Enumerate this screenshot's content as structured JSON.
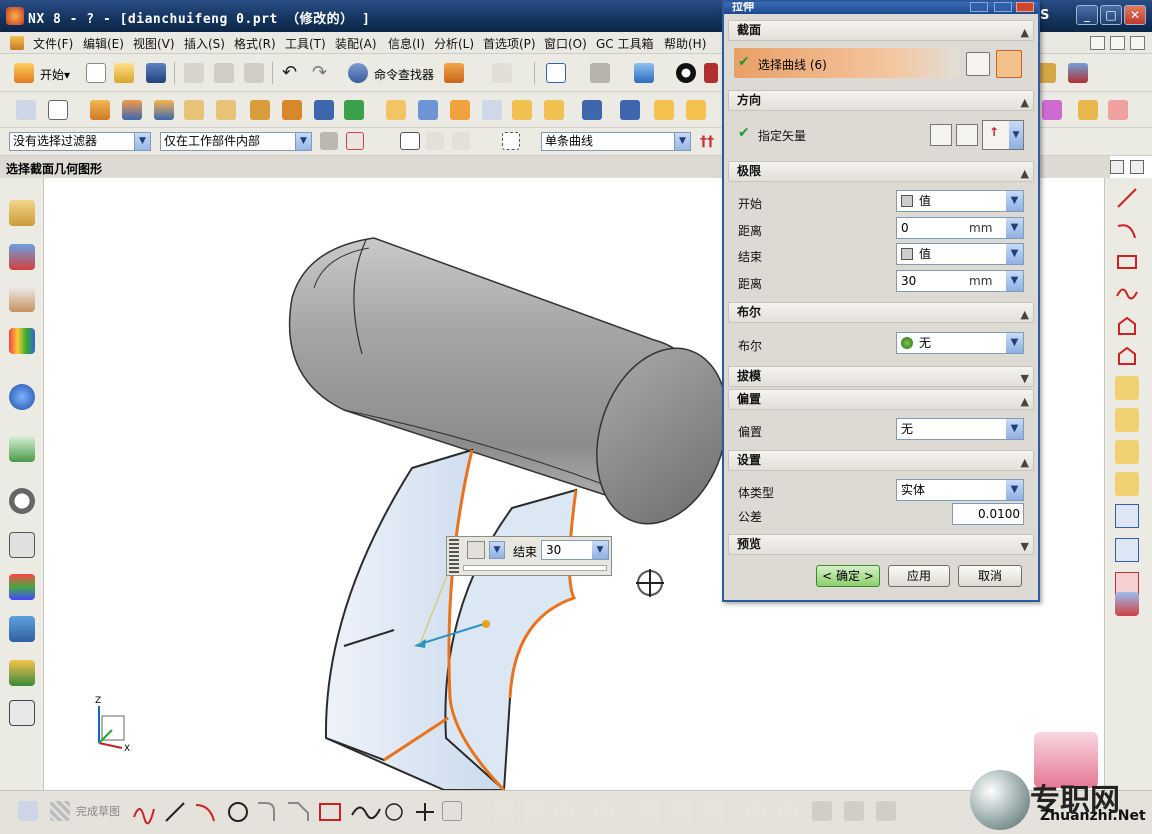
{
  "window": {
    "title": "NX 8 - ? - [dianchuifeng 0.prt （修改的） ]",
    "min": "_",
    "max": "□",
    "close": "✕",
    "brand": "S"
  },
  "menu": [
    "文件(F)",
    "编辑(E)",
    "视图(V)",
    "插入(S)",
    "格式(R)",
    "工具(T)",
    "装配(A)",
    "信息(I)",
    "分析(L)",
    "首选项(P)",
    "窗口(O)",
    "GC 工具箱",
    "帮助(H)"
  ],
  "toolbar1": {
    "start_label": "开始▾",
    "command_finder": "命令查找器"
  },
  "filters": {
    "selection_filter": "没有选择过滤器",
    "scope": "仅在工作部件内部",
    "curve_rule": "单条曲线"
  },
  "status": "选择截面几何图形",
  "dialog": {
    "title": "拉伸",
    "section": {
      "header": "截面",
      "select_curve": "选择曲线 (6)"
    },
    "direction": {
      "header": "方向",
      "specify_vector": "指定矢量"
    },
    "limits": {
      "header": "极限",
      "start_label": "开始",
      "start_value": "值",
      "start_distance_label": "距离",
      "start_distance": "0",
      "start_unit": "mm",
      "end_label": "结束",
      "end_value": "值",
      "end_distance_label": "距离",
      "end_distance": "30",
      "end_unit": "mm"
    },
    "boolean": {
      "header": "布尔",
      "label": "布尔",
      "value": "无"
    },
    "draft": {
      "header": "拔模"
    },
    "offset": {
      "header": "偏置",
      "label": "偏置",
      "value": "无"
    },
    "settings": {
      "header": "设置",
      "body_type_label": "体类型",
      "body_type": "实体",
      "tolerance_label": "公差",
      "tolerance": "0.0100"
    },
    "preview": {
      "header": "预览"
    },
    "ok": "< 确定 >",
    "apply": "应用",
    "cancel": "取消"
  },
  "floating": {
    "label": "结束",
    "value": "30"
  },
  "bottom": {
    "finish_sketch": "完成草图"
  },
  "triad": {
    "z": "Z",
    "x": "X"
  },
  "watermark": {
    "text": "专职网",
    "url": "Zhuanzhi.Net"
  },
  "colors": {
    "titlebar": "#14335d",
    "accent_orange": "#e8731c",
    "check_green": "#1f9a2f",
    "model_gray": "#9a9a9a",
    "sheet_blue": "#d6e4f2"
  }
}
